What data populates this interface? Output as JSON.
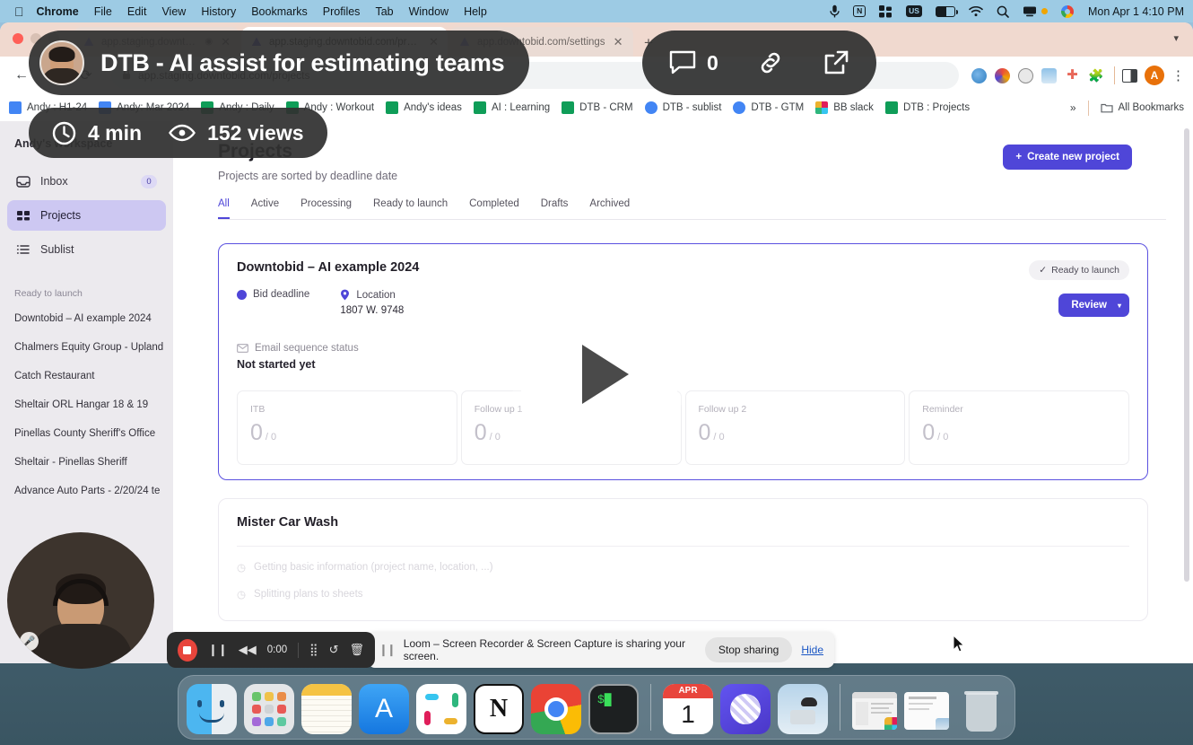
{
  "menubar": {
    "apple": "apple-logo",
    "items": [
      "Chrome",
      "File",
      "Edit",
      "View",
      "History",
      "Bookmarks",
      "Profiles",
      "Tab",
      "Window",
      "Help"
    ],
    "status_icons": [
      "microphone-icon",
      "notion-icon",
      "grid-icon",
      "us-input-icon",
      "battery-charging-icon",
      "wifi-icon",
      "search-icon",
      "screen-share-icon",
      "chrome-icon"
    ],
    "input_label": "US",
    "clock": "Mon Apr 1  4:10 PM"
  },
  "browser": {
    "tabs": [
      {
        "title": "app.staging.downtobid.c",
        "favicon": "downtobid-icon",
        "active": false
      },
      {
        "title": "app.staging.downtobid.com/projects",
        "favicon": "downtobid-icon",
        "active": true
      },
      {
        "title": "app.downtobid.com/settings",
        "favicon": "downtobid-icon",
        "active": false
      }
    ],
    "new_tab": "+",
    "back": "←",
    "forward": "→",
    "reload": "⟳",
    "url": "app.staging.downtobid.com/projects",
    "lock": "🔒",
    "avatar_letter": "A",
    "menu": "⋮",
    "bookmarks": [
      {
        "label": "Andy : H1-24",
        "icon": "doc-icon"
      },
      {
        "label": "Andy: Mar 2024",
        "icon": "doc-icon"
      },
      {
        "label": "Andy : Daily",
        "icon": "sheet-icon"
      },
      {
        "label": "Andy : Workout",
        "icon": "sheet-icon"
      },
      {
        "label": "Andy's ideas",
        "icon": "sheet-icon"
      },
      {
        "label": "AI : Learning",
        "icon": "sheet-icon"
      },
      {
        "label": "DTB - CRM",
        "icon": "sheet-icon"
      },
      {
        "label": "DTB - sublist",
        "icon": "drive-icon"
      },
      {
        "label": "DTB - GTM",
        "icon": "drive-icon"
      },
      {
        "label": "BB slack",
        "icon": "slack-icon"
      },
      {
        "label": "DTB : Projects",
        "icon": "sheet-icon"
      }
    ],
    "overflow": "»",
    "all_bookmarks": "All Bookmarks"
  },
  "app": {
    "workspace": "Andy's workspace",
    "nav": [
      {
        "label": "Inbox",
        "icon": "inbox-icon",
        "badge": "0",
        "active": false
      },
      {
        "label": "Projects",
        "icon": "projects-icon",
        "badge": "",
        "active": true
      },
      {
        "label": "Sublist",
        "icon": "list-icon",
        "badge": "",
        "active": false
      }
    ],
    "section_label": "Ready to launch",
    "projects": [
      "Downtobid – AI example 2024",
      "Chalmers Equity Group - Upland",
      "Catch Restaurant",
      "Sheltair ORL Hangar 18 & 19",
      "Pinellas County Sheriff's Office",
      "Sheltair - Pinellas Sheriff",
      "Advance Auto Parts - 2/20/24 te"
    ],
    "page_title": "Projects",
    "page_subtitle": "Projects are sorted by deadline date",
    "create_button": "Create new project",
    "create_icon": "plus-icon",
    "tabs": [
      {
        "label": "All",
        "active": true
      },
      {
        "label": "Active",
        "active": false
      },
      {
        "label": "Processing",
        "active": false
      },
      {
        "label": "Ready to launch",
        "active": false
      },
      {
        "label": "Completed",
        "active": false
      },
      {
        "label": "Drafts",
        "active": false
      },
      {
        "label": "Archived",
        "active": false
      }
    ],
    "card": {
      "title": "Downtobid – AI example 2024",
      "status": "Ready to launch",
      "status_icon": "check-icon",
      "review_button": "Review",
      "review_chevron": "▾",
      "bid_deadline_label": "Bid deadline",
      "location_label": "Location",
      "location_value": "1807 W.                              9748",
      "email_label": "Email sequence status",
      "email_value": "Not started yet",
      "stats": [
        {
          "label": "ITB",
          "value": "0",
          "denominator": "/ 0"
        },
        {
          "label": "Follow up 1",
          "value": "0",
          "denominator": "/ 0"
        },
        {
          "label": "Follow up 2",
          "value": "0",
          "denominator": "/ 0"
        },
        {
          "label": "Reminder",
          "value": "0",
          "denominator": "/ 0"
        }
      ]
    },
    "card2": {
      "title": "Mister Car Wash",
      "tasks": [
        "Getting basic information (project name, location, ...)",
        "Splitting plans to sheets"
      ]
    }
  },
  "loom": {
    "title": "DTB - AI assist for estimating teams",
    "comment_count": "0",
    "comment_icon": "comment-icon",
    "link_icon": "link-icon",
    "open_icon": "external-link-icon",
    "duration": "4 min",
    "duration_icon": "clock-icon",
    "views": "152 views",
    "views_icon": "eye-icon",
    "play_icon": "play-icon",
    "controls": {
      "stop": "stop-icon",
      "pause": "pause-icon",
      "rewind": "rewind-icon",
      "time": "0:00",
      "grid": "grid-icon",
      "restart": "restart-icon",
      "delete": "trash-icon"
    }
  },
  "share_bar": {
    "grip": "drag-handle-icon",
    "message": "Loom – Screen Recorder & Screen Capture is sharing your screen.",
    "stop_button": "Stop sharing",
    "hide_button": "Hide"
  },
  "dock": {
    "apps": [
      "finder-icon",
      "launchpad-icon",
      "notes-icon",
      "app-store-icon",
      "slack-icon",
      "notion-icon",
      "chrome-icon",
      "terminal-icon"
    ],
    "right_apps": [
      "calendar-icon",
      "loom-icon",
      "image-capture-icon"
    ],
    "minimized": [
      "window-thumbnail-1",
      "window-thumbnail-2"
    ],
    "trash": "trash-icon",
    "calendar_month": "APR",
    "calendar_day": "1"
  },
  "colors": {
    "accent": "#4f46d8",
    "sidebar_active": "#cdc8f2",
    "menubar": "#9dcbe4",
    "loom_overlay": "#303030",
    "record_red": "#e8453c"
  }
}
